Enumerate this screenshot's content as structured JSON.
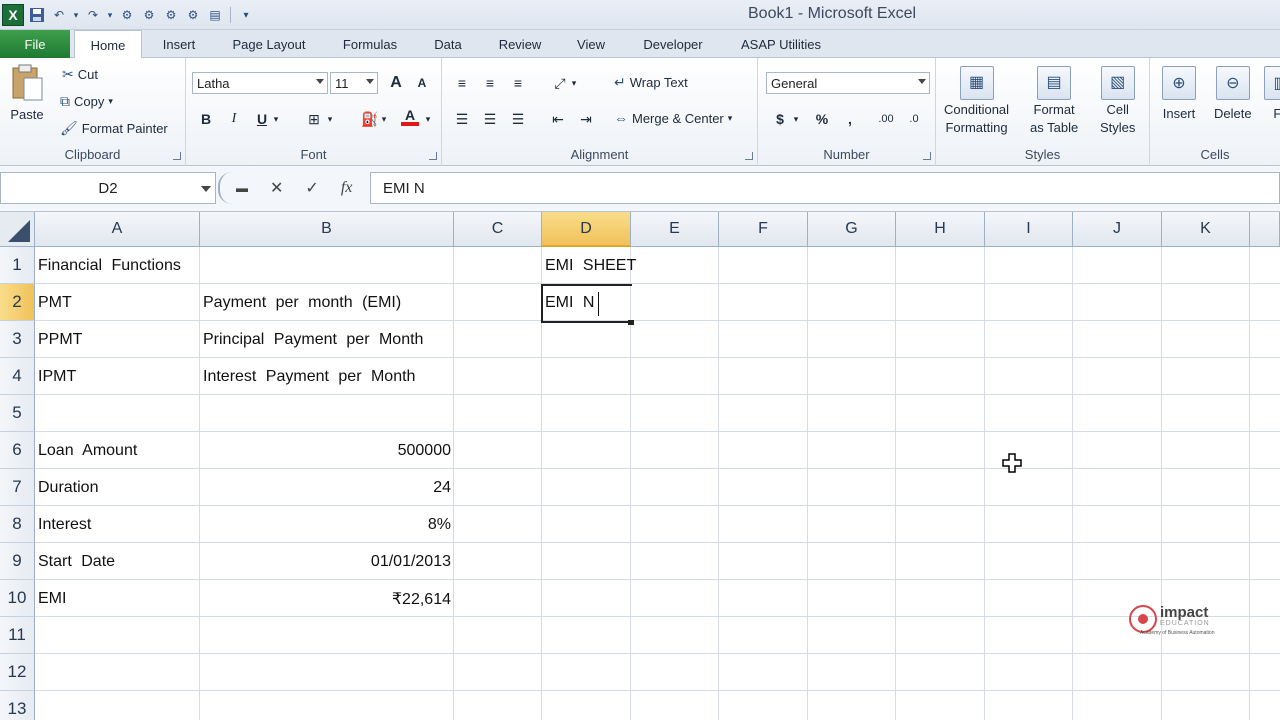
{
  "app": {
    "window_title": "Book1  -  Microsoft Excel"
  },
  "tabs": [
    "File",
    "Home",
    "Insert",
    "Page Layout",
    "Formulas",
    "Data",
    "Review",
    "View",
    "Developer",
    "ASAP Utilities"
  ],
  "active_tab": "Home",
  "ribbon": {
    "clipboard": {
      "label": "Clipboard",
      "paste": "Paste",
      "cut": "Cut",
      "copy": "Copy",
      "format_painter": "Format Painter"
    },
    "font": {
      "label": "Font",
      "font_name": "Latha",
      "font_size": "11",
      "bold": "B",
      "italic": "I",
      "underline": "U",
      "font_color_glyph": "A",
      "grow_font": "A",
      "shrink_font": "A"
    },
    "alignment": {
      "label": "Alignment",
      "wrap_text": "Wrap Text",
      "merge_center": "Merge & Center"
    },
    "number": {
      "label": "Number",
      "format": "General",
      "currency": "$",
      "percent": "%",
      "comma": ","
    },
    "styles": {
      "label": "Styles",
      "conditional_formatting_1": "Conditional",
      "conditional_formatting_2": "Formatting",
      "format_table_1": "Format",
      "format_table_2": "as Table",
      "cell_styles_1": "Cell",
      "cell_styles_2": "Styles"
    },
    "cells": {
      "label": "Cells",
      "insert": "Insert",
      "delete": "Delete",
      "format": "Fo"
    }
  },
  "formula_bar": {
    "name_box": "D2",
    "formula": "EMI  N"
  },
  "columns": [
    "A",
    "B",
    "C",
    "D",
    "E",
    "F",
    "G",
    "H",
    "I",
    "J",
    "K"
  ],
  "rows": [
    "1",
    "2",
    "3",
    "4",
    "5",
    "6",
    "7",
    "8",
    "9",
    "10",
    "11",
    "12",
    "13"
  ],
  "selected_column": "D",
  "selected_row": "2",
  "cells": {
    "A1": "Financial  Functions",
    "D1": "EMI  SHEET",
    "A2": "PMT",
    "B2": "Payment  per  month  (EMI)",
    "D2": "EMI  N",
    "A3": "PPMT",
    "B3": "Principal  Payment  per  Month",
    "A4": "IPMT",
    "B4": "Interest  Payment  per  Month",
    "A6": "Loan  Amount",
    "B6": "500000",
    "A7": "Duration",
    "B7": "24",
    "A8": "Interest",
    "B8": "8%",
    "A9": "Start  Date",
    "B9": "01/01/2013",
    "A10": "EMI",
    "B10": "₹22,614"
  },
  "watermark": {
    "name": "impact",
    "sub": "EDUCATION",
    "tagline": "Academy of Business Automation"
  }
}
